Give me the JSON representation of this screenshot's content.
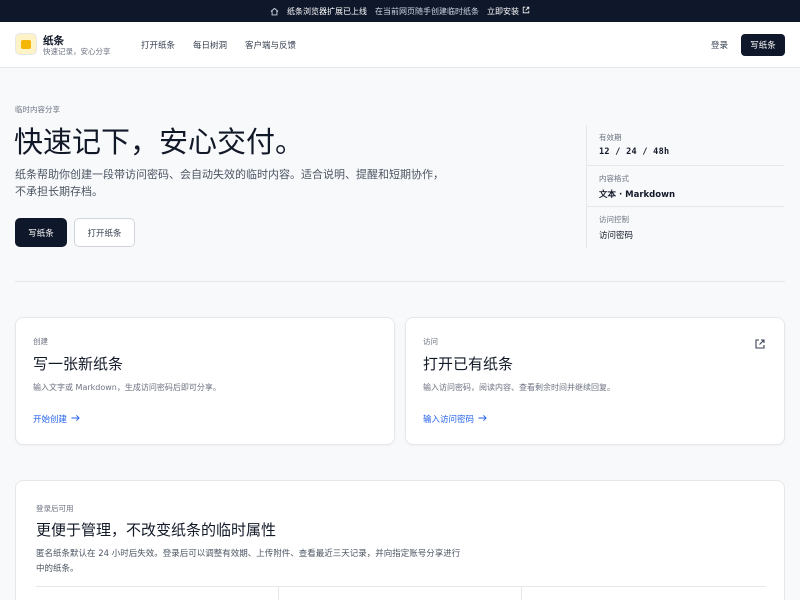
{
  "banner": {
    "icon": "home-icon",
    "title": "纸条浏览器扩展已上线",
    "subtitle": "在当前网页随手创建临时纸条",
    "link": "立即安装",
    "link_icon": "external-link-icon"
  },
  "header": {
    "brand_name": "纸条",
    "brand_tagline": "快速记录，安心分享",
    "nav": [
      "打开纸条",
      "每日树洞",
      "客户端与反馈"
    ],
    "login": "登录",
    "write_button": "写纸条"
  },
  "hero": {
    "eyebrow": "临时内容分享",
    "title": "快速记下，安心交付。",
    "description": "纸条帮助你创建一段带访问密码、会自动失效的临时内容。适合说明、提醒和短期协作，不承担长期存档。",
    "primary_button": "写纸条",
    "secondary_button": "打开纸条"
  },
  "facts": [
    {
      "label": "有效期",
      "value": "12 / 24 / 48h"
    },
    {
      "label": "内容格式",
      "value": "文本 · Markdown"
    },
    {
      "label": "访问控制",
      "value": "访问密码"
    }
  ],
  "cards": [
    {
      "eyebrow": "创建",
      "title": "写一张新纸条",
      "description": "输入文字或 Markdown，生成访问密码后即可分享。",
      "link": "开始创建"
    },
    {
      "eyebrow": "访问",
      "title": "打开已有纸条",
      "description": "输入访问密码，阅读内容、查看剩余时间并继续回复。",
      "link": "输入访问密码",
      "icon": "external-link-icon"
    }
  ],
  "manage": {
    "eyebrow": "登录后可用",
    "title": "更便于管理，不改变纸条的临时属性",
    "description": "匿名纸条默认在 24 小时后失效。登录后可以调整有效期、上传附件、查看最近三天记录，并向指定账号分享进行中的纸条。"
  },
  "colors": {
    "dark": "#0f172a",
    "link": "#2563eb",
    "logo": "#f5b60a"
  }
}
